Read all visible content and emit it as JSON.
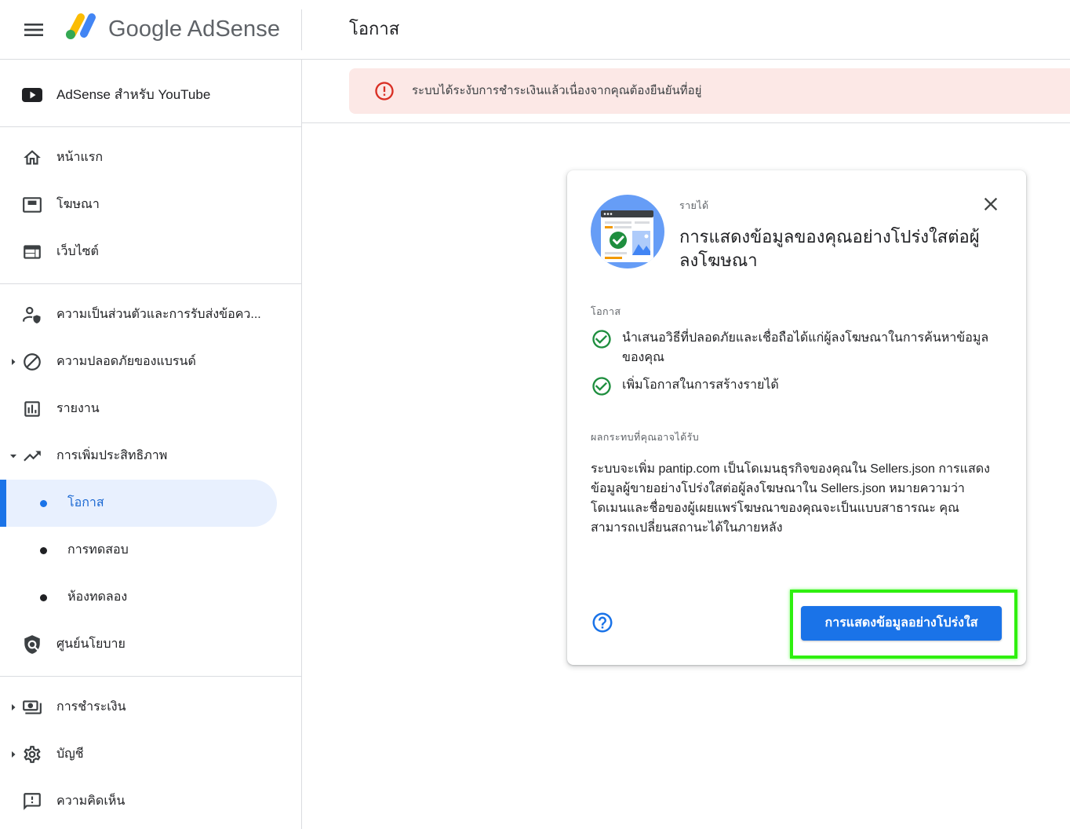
{
  "theme": {
    "accent": "#1a73e8",
    "selected_bg": "#e8f0fe",
    "alert_bg": "#fce8e6",
    "error": "#d93025",
    "success": "#1e8e3e",
    "highlight": "#2ff00f"
  },
  "header": {
    "menu_icon": "menu-icon",
    "logo_icon": "adsense-logo-icon",
    "logo_text": "Google AdSense",
    "page_title": "โอกาส"
  },
  "sidebar": {
    "items": [
      {
        "label": "AdSense สำหรับ YouTube",
        "icon": "youtube-icon"
      },
      {
        "label": "หน้าแรก",
        "icon": "home-icon"
      },
      {
        "label": "โฆษณา",
        "icon": "ads-icon"
      },
      {
        "label": "เว็บไซต์",
        "icon": "web-icon"
      },
      {
        "label": "ความเป็นส่วนตัวและการรับส่งข้อคว...",
        "icon": "privacy-messaging-icon"
      },
      {
        "label": "ความปลอดภัยของแบรนด์",
        "icon": "block-icon",
        "expanded": false
      },
      {
        "label": "รายงาน",
        "icon": "reports-icon"
      },
      {
        "label": "การเพิ่มประสิทธิภาพ",
        "icon": "trending-up-icon",
        "expanded": true
      },
      {
        "label": "โอกาส",
        "icon": "dot-icon",
        "selected": true
      },
      {
        "label": "การทดสอบ",
        "icon": "dot-icon"
      },
      {
        "label": "ห้องทดลอง",
        "icon": "dot-icon"
      },
      {
        "label": "ศูนย์นโยบาย",
        "icon": "policy-icon"
      },
      {
        "label": "การชำระเงิน",
        "icon": "payments-icon",
        "expanded": false
      },
      {
        "label": "บัญชี",
        "icon": "settings-icon",
        "expanded": false
      },
      {
        "label": "ความคิดเห็น",
        "icon": "feedback-icon"
      }
    ]
  },
  "alert": {
    "icon": "error-icon",
    "text": "ระบบได้ระงับการชำระเงินแล้วเนื่องจากคุณต้องยืนยันที่อยู่"
  },
  "card": {
    "illustration": "transparency-illustration-icon",
    "category": "รายได้",
    "close_icon": "close-icon",
    "title": "การแสดงข้อมูลของคุณอย่างโปร่งใสต่อผู้ลงโฆษณา",
    "opportunity_label": "โอกาส",
    "benefits": [
      "นำเสนอวิธีที่ปลอดภัยและเชื่อถือได้แก่ผู้ลงโฆษณาในการค้นหาข้อมูลของคุณ",
      "เพิ่มโอกาสในการสร้างรายได้"
    ],
    "impact_label": "ผลกระทบที่คุณอาจได้รับ",
    "impact_text": "ระบบจะเพิ่ม pantip.com เป็นโดเมนธุรกิจของคุณใน Sellers.json การแสดงข้อมูลผู้ขายอย่างโปร่งใสต่อผู้ลงโฆษณาใน Sellers.json หมายความว่าโดเมนและชื่อของผู้เผยแพร่โฆษณาของคุณจะเป็นแบบสาธารณะ คุณสามารถเปลี่ยนสถานะได้ในภายหลัง",
    "help_icon": "help-icon",
    "button_label": "การแสดงข้อมูลอย่างโปร่งใส"
  }
}
